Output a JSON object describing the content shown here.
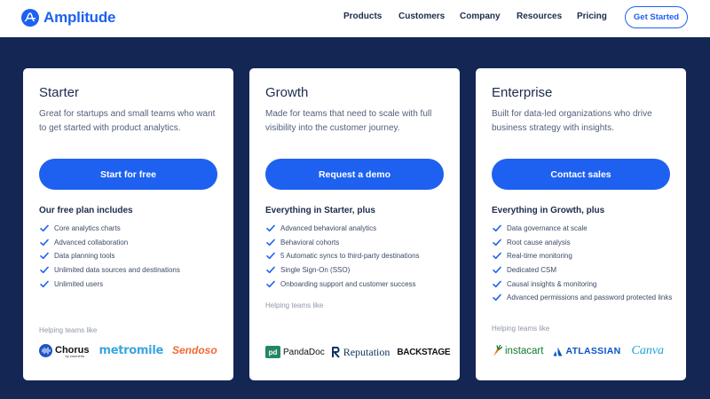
{
  "header": {
    "logo_text": "Amplitude",
    "nav": [
      "Products",
      "Customers",
      "Company",
      "Resources",
      "Pricing"
    ],
    "cta_label": "Get Started"
  },
  "plans": [
    {
      "title": "Starter",
      "description": "Great for startups and small teams who want to get started with product analytics.",
      "button": "Start for free",
      "subheading": "Our free plan includes",
      "features": [
        "Core analytics charts",
        "Advanced collaboration",
        "Data planning tools",
        "Unlimited data sources and destinations",
        "Unlimited users"
      ],
      "helping": "Helping teams like",
      "logos": [
        "Chorus",
        "metromile",
        "Sendoso"
      ],
      "logo_sub": "by zoominfo"
    },
    {
      "title": "Growth",
      "description": "Made for teams that need to scale with full visibility into the customer journey.",
      "button": "Request a demo",
      "subheading": "Everything in Starter, plus",
      "features": [
        "Advanced behavioral analytics",
        "Behavioral cohorts",
        "5 Automatic syncs to third-party destinations",
        "Single Sign-On (SSO)",
        "Onboarding support and customer success"
      ],
      "helping": "Helping teams like",
      "logos": [
        "PandaDoc",
        "Reputation",
        "BACKSTAGE"
      ]
    },
    {
      "title": "Enterprise",
      "description": "Built for data-led organizations who drive business strategy with insights.",
      "button": "Contact sales",
      "subheading": "Everything in Growth, plus",
      "features": [
        "Data governance at scale",
        "Root cause analysis",
        "Real-time monitoring",
        "Dedicated CSM",
        "Causal insights & monitoring",
        "Advanced permissions and password protected links"
      ],
      "helping": "Helping teams like",
      "logos": [
        "instacart",
        "ATLASSIAN",
        "Canva"
      ]
    }
  ],
  "colors": {
    "brand": "#1e61f0",
    "page_background": "#142653",
    "card_background": "#ffffff"
  }
}
